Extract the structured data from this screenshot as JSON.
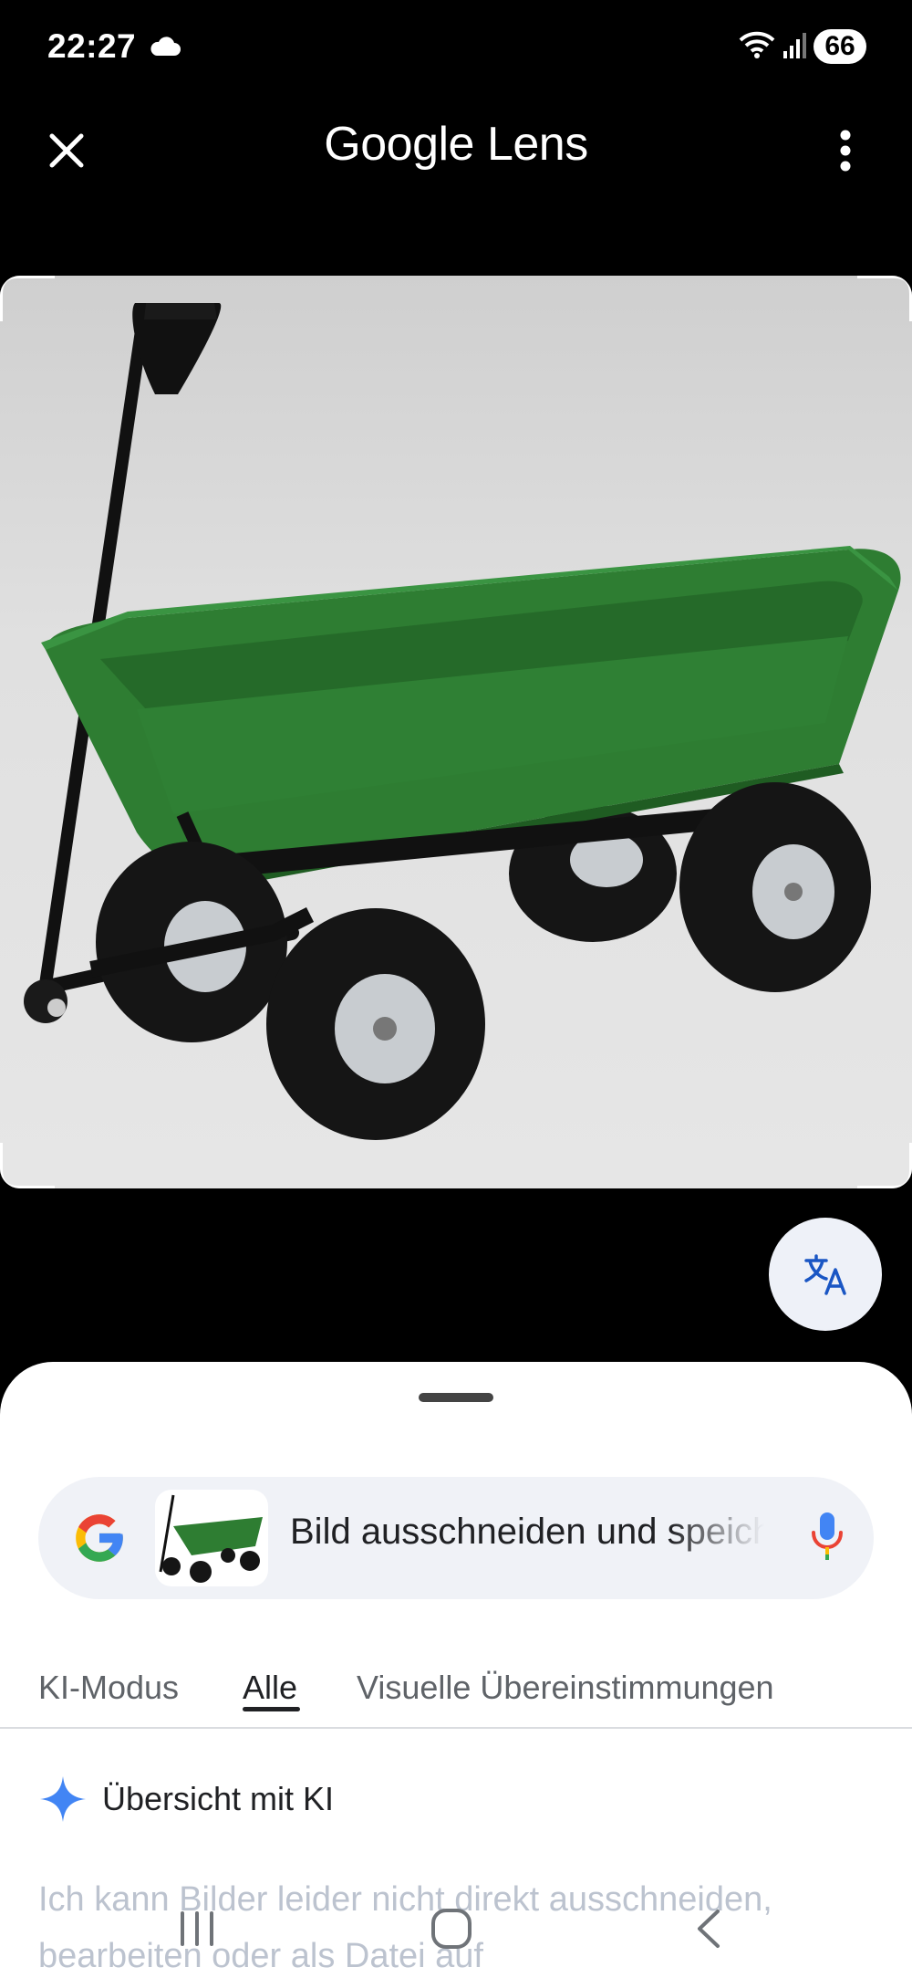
{
  "status_bar": {
    "time": "22:27",
    "battery": "66",
    "icons": [
      "cloud-icon",
      "wifi-icon",
      "signal-icon",
      "battery-icon"
    ]
  },
  "top_bar": {
    "title_brand": "Google",
    "title_product": "Lens",
    "close_icon": "close-icon",
    "menu_icon": "more-vert-icon"
  },
  "image": {
    "subject": "green garden dump cart",
    "colors": {
      "tub": "#2e7d32",
      "frame": "#111111",
      "tire": "#151515",
      "hub": "#c8ccd0"
    }
  },
  "translate_button": {
    "icon": "translate-icon"
  },
  "search": {
    "query": "Bild ausschneiden und speichern",
    "logo": "google-g-icon",
    "mic_icon": "mic-icon"
  },
  "tabs": [
    {
      "label": "KI-Modus",
      "active": false
    },
    {
      "label": "Alle",
      "active": true
    },
    {
      "label": "Visuelle Übereinstimmungen",
      "active": false
    }
  ],
  "ai_overview": {
    "title": "Übersicht mit KI",
    "icon": "sparkle-icon",
    "text": "Ich kann Bilder leider nicht direkt ausschneiden, bearbeiten oder als Datei auf"
  },
  "nav_bar": {
    "buttons": [
      "recents-icon",
      "home-icon",
      "back-icon"
    ]
  },
  "colors": {
    "accent_blue": "#4285f4",
    "google_red": "#ea4335",
    "google_yellow": "#fbbc05",
    "google_green": "#34a853"
  }
}
